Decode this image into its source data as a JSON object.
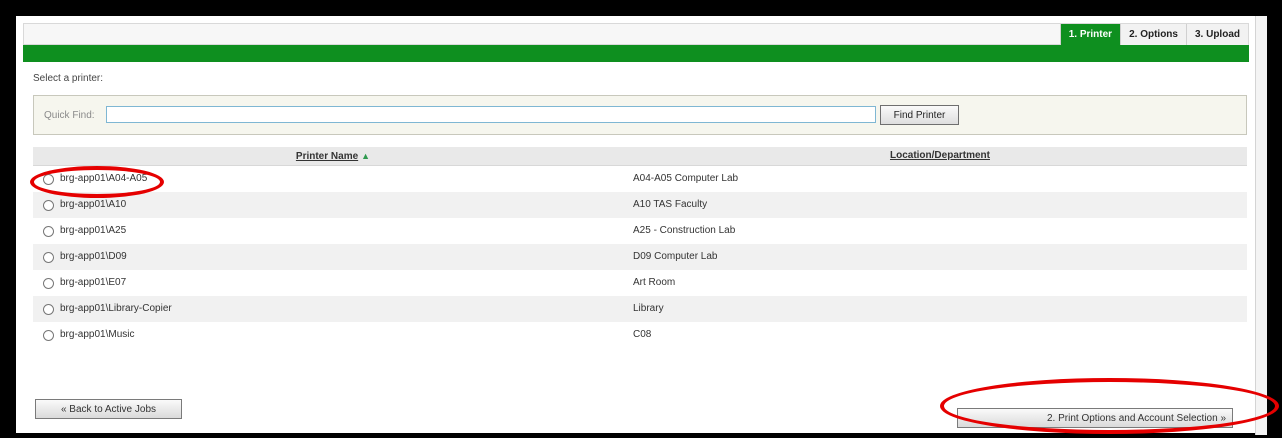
{
  "tabs": [
    {
      "label": "1. Printer",
      "active": true
    },
    {
      "label": "2. Options",
      "active": false
    },
    {
      "label": "3. Upload",
      "active": false
    }
  ],
  "select_label": "Select a printer:",
  "quick_find": {
    "label": "Quick Find:",
    "value": "",
    "placeholder": "",
    "button_label": "Find Printer"
  },
  "table": {
    "columns": [
      "Printer Name",
      "Location/Department"
    ],
    "sort_icon": "sort-ascending-icon",
    "rows": [
      {
        "name": "brg-app01\\A04-A05",
        "location": "A04-A05 Computer Lab"
      },
      {
        "name": "brg-app01\\A10",
        "location": "A10 TAS Faculty"
      },
      {
        "name": "brg-app01\\A25",
        "location": "A25 - Construction Lab"
      },
      {
        "name": "brg-app01\\D09",
        "location": "D09 Computer Lab"
      },
      {
        "name": "brg-app01\\E07",
        "location": "Art Room"
      },
      {
        "name": "brg-app01\\Library-Copier",
        "location": "Library"
      },
      {
        "name": "brg-app01\\Music",
        "location": "C08"
      }
    ]
  },
  "buttons": {
    "back": "« Back to Active Jobs",
    "next": "2. Print Options and Account Selection »"
  },
  "colors": {
    "brand_green": "#0e8f1f",
    "annotation_red": "#e50000"
  }
}
